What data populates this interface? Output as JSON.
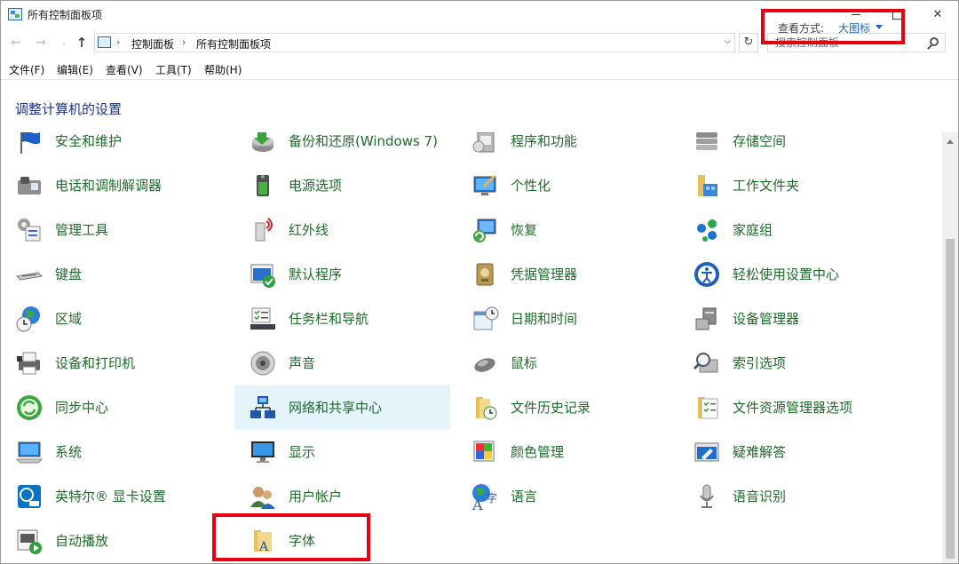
{
  "window": {
    "title": "所有控制面板项"
  },
  "nav": {
    "back": "←",
    "forward": "→",
    "recent": "⌄",
    "up": "↑",
    "refresh": "↻",
    "breadcrumbs": [
      "控制面板",
      "所有控制面板项"
    ],
    "search_placeholder": "搜索控制面板"
  },
  "menu": {
    "file": "文件(F)",
    "edit": "编辑(E)",
    "view": "查看(V)",
    "tools": "工具(T)",
    "help": "帮助(H)"
  },
  "header": {
    "title": "调整计算机的设置",
    "view_by_label": "查看方式:",
    "view_by_value": "大图标"
  },
  "items": [
    {
      "label": "安全和维护",
      "icon": "flag-icon"
    },
    {
      "label": "备份和还原(Windows 7)",
      "icon": "backup-icon"
    },
    {
      "label": "程序和功能",
      "icon": "programs-icon"
    },
    {
      "label": "存储空间",
      "icon": "storage-icon"
    },
    {
      "label": "电话和调制解调器",
      "icon": "phone-icon"
    },
    {
      "label": "电源选项",
      "icon": "battery-icon"
    },
    {
      "label": "个性化",
      "icon": "personalize-icon"
    },
    {
      "label": "工作文件夹",
      "icon": "work-folder-icon"
    },
    {
      "label": "管理工具",
      "icon": "admin-tools-icon"
    },
    {
      "label": "红外线",
      "icon": "infrared-icon"
    },
    {
      "label": "恢复",
      "icon": "recovery-icon"
    },
    {
      "label": "家庭组",
      "icon": "homegroup-icon"
    },
    {
      "label": "键盘",
      "icon": "keyboard-icon"
    },
    {
      "label": "默认程序",
      "icon": "default-programs-icon"
    },
    {
      "label": "凭据管理器",
      "icon": "credential-icon"
    },
    {
      "label": "轻松使用设置中心",
      "icon": "ease-of-access-icon"
    },
    {
      "label": "区域",
      "icon": "globe-clock-icon"
    },
    {
      "label": "任务栏和导航",
      "icon": "taskbar-icon"
    },
    {
      "label": "日期和时间",
      "icon": "calendar-icon"
    },
    {
      "label": "设备管理器",
      "icon": "device-manager-icon"
    },
    {
      "label": "设备和打印机",
      "icon": "printer-icon"
    },
    {
      "label": "声音",
      "icon": "speaker-icon"
    },
    {
      "label": "鼠标",
      "icon": "mouse-icon"
    },
    {
      "label": "索引选项",
      "icon": "index-icon"
    },
    {
      "label": "同步中心",
      "icon": "sync-icon"
    },
    {
      "label": "网络和共享中心",
      "icon": "network-icon"
    },
    {
      "label": "文件历史记录",
      "icon": "file-history-icon"
    },
    {
      "label": "文件资源管理器选项",
      "icon": "folder-options-icon"
    },
    {
      "label": "系统",
      "icon": "system-icon"
    },
    {
      "label": "显示",
      "icon": "display-icon"
    },
    {
      "label": "颜色管理",
      "icon": "color-management-icon"
    },
    {
      "label": "疑难解答",
      "icon": "troubleshoot-icon"
    },
    {
      "label": "英特尔® 显卡设置",
      "icon": "intel-graphics-icon"
    },
    {
      "label": "用户帐户",
      "icon": "user-accounts-icon"
    },
    {
      "label": "语言",
      "icon": "language-icon"
    },
    {
      "label": "语音识别",
      "icon": "microphone-icon"
    },
    {
      "label": "自动播放",
      "icon": "autoplay-icon"
    },
    {
      "label": "字体",
      "icon": "fonts-icon"
    }
  ],
  "selected_item": "网络和共享中心",
  "colors": {
    "link_green": "#1e6b2a",
    "title_blue": "#1e3287",
    "accent_blue": "#1e64c8",
    "highlight_red": "#e50012",
    "hover_bg": "#e5f3fb"
  }
}
